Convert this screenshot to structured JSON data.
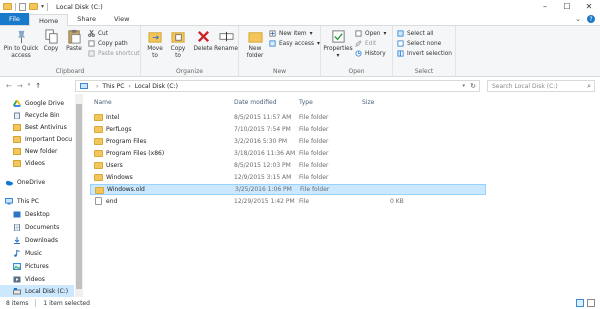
{
  "window": {
    "title": "Local Disk (C:)",
    "controls": [
      "–",
      "☐",
      "✕"
    ]
  },
  "ribbon_tabs": [
    "File",
    "Home",
    "Share",
    "View"
  ],
  "ribbon": {
    "clipboard": {
      "label": "Clipboard",
      "pin": "Pin to Quick access",
      "copy": "Copy",
      "paste": "Paste",
      "cut": "Cut",
      "copy_path": "Copy path",
      "paste_shortcut": "Paste shortcut"
    },
    "organize": {
      "label": "Organize",
      "move_to": "Move to",
      "copy_to": "Copy to",
      "delete": "Delete",
      "rename": "Rename"
    },
    "new": {
      "label": "New",
      "new_folder": "New folder",
      "new_item": "New item",
      "easy_access": "Easy access"
    },
    "open": {
      "label": "Open",
      "properties": "Properties",
      "open": "Open",
      "edit": "Edit",
      "history": "History"
    },
    "select": {
      "label": "Select",
      "select_all": "Select all",
      "select_none": "Select none",
      "invert": "Invert selection"
    }
  },
  "address": {
    "crumbs": [
      "This PC",
      "Local Disk (C:)"
    ],
    "search_placeholder": "Search Local Disk (C:)"
  },
  "nav_pane": [
    {
      "label": "Google Drive",
      "icon": "google-drive-icon"
    },
    {
      "label": "Recycle Bin",
      "icon": "recycle-bin-icon"
    },
    {
      "label": "Best Antivirus",
      "icon": "folder-icon"
    },
    {
      "label": "Important Docu",
      "icon": "folder-icon"
    },
    {
      "label": "New folder",
      "icon": "folder-icon"
    },
    {
      "label": "Videos",
      "icon": "folder-icon"
    },
    {
      "label": "OneDrive",
      "icon": "onedrive-icon"
    },
    {
      "label": "This PC",
      "icon": "pc-icon"
    },
    {
      "label": "Desktop",
      "icon": "desktop-icon"
    },
    {
      "label": "Documents",
      "icon": "documents-icon"
    },
    {
      "label": "Downloads",
      "icon": "downloads-icon"
    },
    {
      "label": "Music",
      "icon": "music-icon"
    },
    {
      "label": "Pictures",
      "icon": "pictures-icon"
    },
    {
      "label": "Videos",
      "icon": "videos-icon"
    },
    {
      "label": "Local Disk (C:)",
      "icon": "drive-icon"
    }
  ],
  "columns": [
    "Name",
    "Date modified",
    "Type",
    "Size"
  ],
  "files": [
    {
      "name": "Intel",
      "date": "8/5/2015 11:57 AM",
      "type": "File folder",
      "size": ""
    },
    {
      "name": "PerfLogs",
      "date": "7/10/2015 7:54 PM",
      "type": "File folder",
      "size": ""
    },
    {
      "name": "Program Files",
      "date": "3/2/2016 5:30 PM",
      "type": "File folder",
      "size": ""
    },
    {
      "name": "Program Files (x86)",
      "date": "3/18/2016 11:36 AM",
      "type": "File folder",
      "size": ""
    },
    {
      "name": "Users",
      "date": "8/5/2015 12:03 PM",
      "type": "File folder",
      "size": ""
    },
    {
      "name": "Windows",
      "date": "12/9/2015 3:15 AM",
      "type": "File folder",
      "size": ""
    },
    {
      "name": "Windows.old",
      "date": "3/25/2016 1:06 PM",
      "type": "File folder",
      "size": ""
    },
    {
      "name": "end",
      "date": "12/29/2015 1:42 PM",
      "type": "File",
      "size": "0 KB"
    }
  ],
  "status": {
    "items": "8 items",
    "selected": "1 item selected"
  },
  "colors": {
    "file_tab": "#1979ca",
    "selection": "#cce8ff",
    "folder": "#f3c55a"
  }
}
